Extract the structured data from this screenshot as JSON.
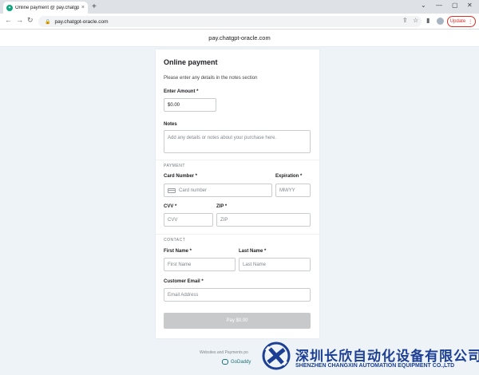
{
  "browser": {
    "tab_title": "Online payment @ pay.chatgpt-o",
    "tab_close": "×",
    "new_tab": "+",
    "url": "pay.chatgpt-oracle.com",
    "update_label": "Update",
    "favicon_glyph": "✦"
  },
  "site": {
    "header": "pay.chatgpt-oracle.com"
  },
  "form": {
    "title": "Online payment",
    "subtitle": "Please enter any details in the notes section",
    "amount": {
      "label": "Enter Amount *",
      "value": "$0.00"
    },
    "notes": {
      "label": "Notes",
      "placeholder": "Add any details or notes about your purchase here."
    },
    "payment_section": "PAYMENT",
    "card_number": {
      "label": "Card Number *",
      "placeholder": "Card number"
    },
    "expiration": {
      "label": "Expiration *",
      "placeholder": "MM/YY"
    },
    "cvv": {
      "label": "CVV *",
      "placeholder": "CVV"
    },
    "zip": {
      "label": "ZIP *",
      "placeholder": "ZIP"
    },
    "contact_section": "CONTACT",
    "first_name": {
      "label": "First Name *",
      "placeholder": "First Name"
    },
    "last_name": {
      "label": "Last Name *",
      "placeholder": "Last Name"
    },
    "email": {
      "label": "Customer Email *",
      "placeholder": "Email Address"
    },
    "pay_button": "Pay $0.00"
  },
  "footer": {
    "text": "Websites and Payments po",
    "brand": "GoDaddy"
  },
  "watermark": {
    "cn": "深圳长欣自动化设备有限公司",
    "en": "SHENZHEN CHANGXIN AUTOMATION EQUIPMENT CO.,LTD"
  }
}
